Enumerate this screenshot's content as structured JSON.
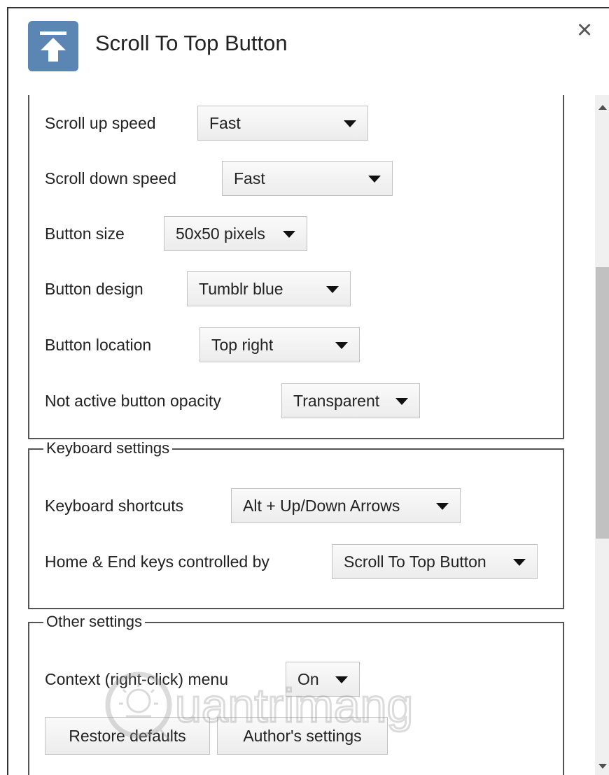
{
  "window": {
    "title": "Scroll To Top Button",
    "close_glyph": "×",
    "app_icon": "scroll-to-top-icon",
    "accent_color": "#5b86b3"
  },
  "general": {
    "rows": [
      {
        "label": "Scroll up speed",
        "value": "Fast"
      },
      {
        "label": "Scroll down speed",
        "value": "Fast"
      },
      {
        "label": "Button size",
        "value": "50x50 pixels"
      },
      {
        "label": "Button design",
        "value": "Tumblr blue"
      },
      {
        "label": "Button location",
        "value": "Top right"
      },
      {
        "label": "Not active button opacity",
        "value": "Transparent"
      }
    ]
  },
  "keyboard": {
    "legend": "Keyboard settings",
    "rows": [
      {
        "label": "Keyboard shortcuts",
        "value": "Alt + Up/Down Arrows"
      },
      {
        "label": "Home & End keys controlled by",
        "value": "Scroll To Top Button"
      }
    ]
  },
  "other": {
    "legend": "Other settings",
    "rows": [
      {
        "label": "Context (right-click) menu",
        "value": "On"
      }
    ],
    "buttons": {
      "restore": "Restore defaults",
      "author": "Author's settings"
    }
  },
  "watermark": {
    "text": "uantrimang"
  }
}
